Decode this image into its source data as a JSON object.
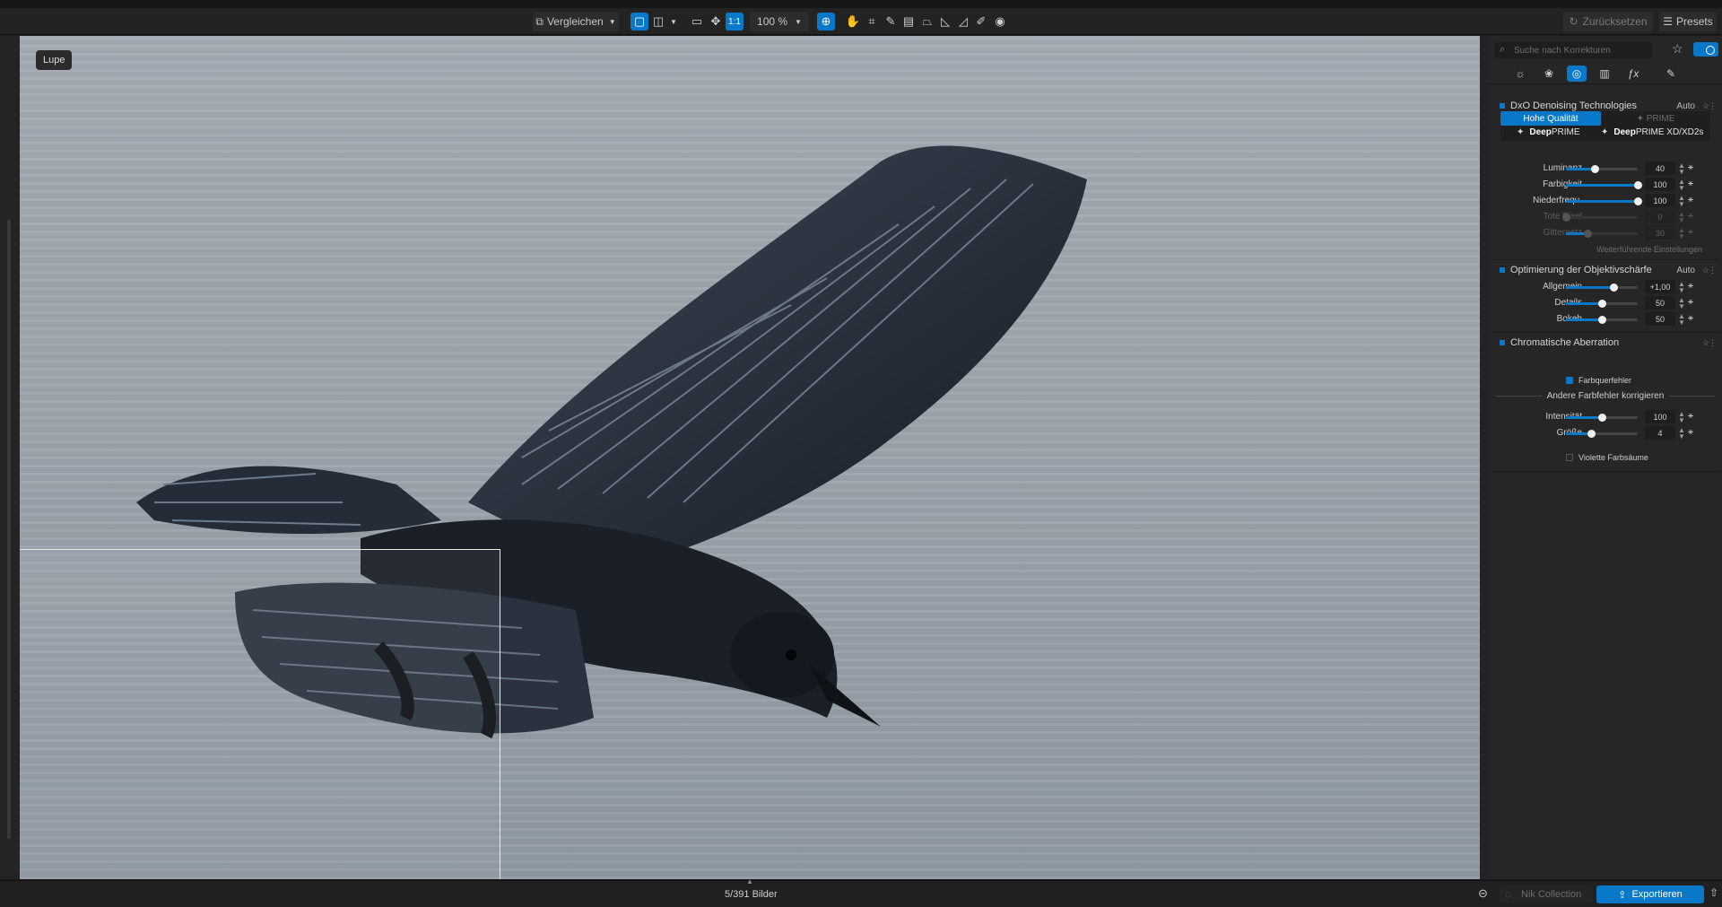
{
  "toolbar": {
    "compare": "Vergleichen",
    "one_to_one": "1:1",
    "zoom": "100 %",
    "reset": "Zurücksetzen",
    "presets": "Presets"
  },
  "viewer": {
    "lupe_label": "Lupe"
  },
  "panel": {
    "search_placeholder": "Suche nach Korrekturen",
    "denoise": {
      "title": "DxO Denoising Technologies",
      "auto": "Auto",
      "quality_active": "Hohe Qualität",
      "quality_other": "PRIME",
      "mode1_bold": "Deep",
      "mode1_rest": "PRIME",
      "mode2_bold": "Deep",
      "mode2_rest": "PRIME XD/XD2s",
      "sliders": [
        {
          "label": "Luminanz",
          "value": "40",
          "fraction": 0.4
        },
        {
          "label": "Farbigkeit",
          "value": "100",
          "fraction": 1.0
        },
        {
          "label": "Niederfrequ.",
          "value": "100",
          "fraction": 1.0
        },
        {
          "label": "Tote Pixel",
          "value": "0",
          "fraction": 0.0
        },
        {
          "label": "Gitternetz",
          "value": "30",
          "fraction": 0.3
        }
      ],
      "further": "Weiterführende Einstellungen"
    },
    "sharpness": {
      "title": "Optimierung der Objektivschärfe",
      "auto": "Auto",
      "sliders": [
        {
          "label": "Allgemein",
          "value": "+1,00",
          "fraction": 0.66
        },
        {
          "label": "Details",
          "value": "50",
          "fraction": 0.5
        },
        {
          "label": "Bokeh",
          "value": "50",
          "fraction": 0.5
        }
      ]
    },
    "chromatic": {
      "title": "Chromatische Aberration",
      "check1": "Farbquerfehler",
      "divider": "Andere Farbfehler korrigieren",
      "sliders": [
        {
          "label": "Intensität",
          "value": "100",
          "fraction": 0.5
        },
        {
          "label": "Größe",
          "value": "4",
          "fraction": 0.35
        }
      ],
      "check2": "Violette Farbsäume"
    }
  },
  "status": {
    "count": "5/391 Bilder",
    "nik": "Nik Collection",
    "export": "Exportieren"
  },
  "colors": {
    "accent": "#0a78c8",
    "panel": "#262626"
  }
}
